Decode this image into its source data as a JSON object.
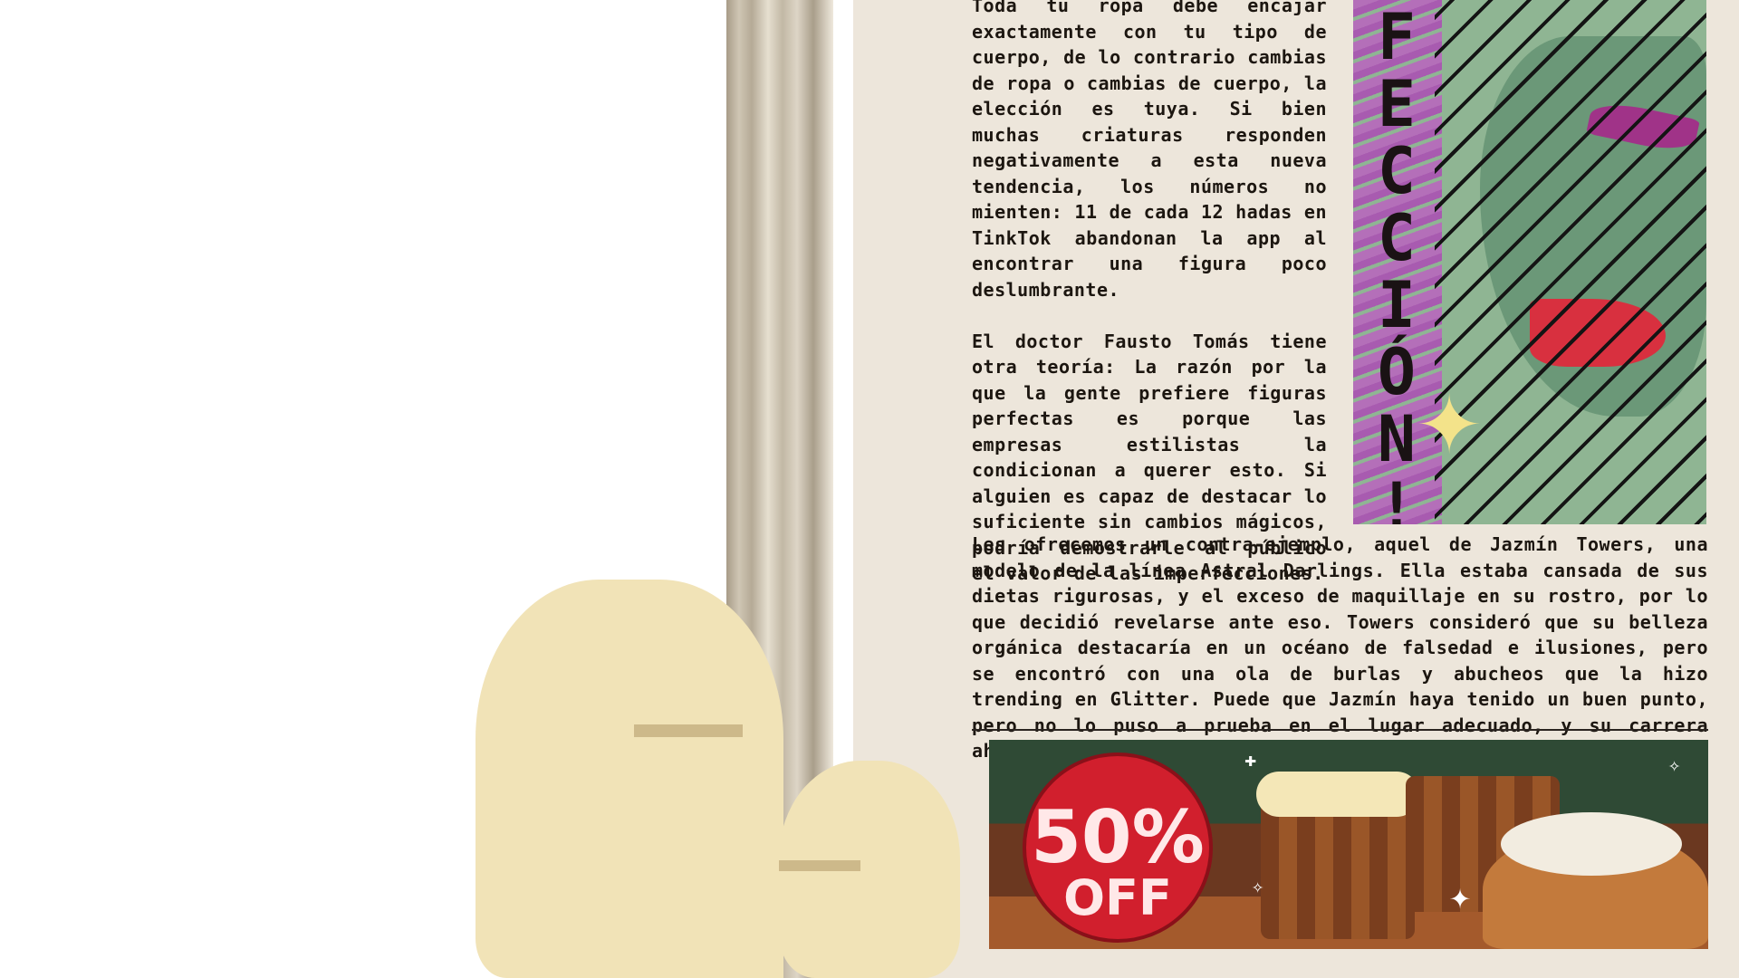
{
  "article": {
    "paragraphs": [
      "Toda tu ropa debe encajar exactamente con tu tipo de cuerpo, de lo contrario cambias de ropa o cambias de cuerpo, la elección es tuya. Si bien muchas criaturas responden negativamente a esta nueva tendencia, los números no mienten: 11 de cada 12 hadas en TinkTok abandonan la app al encontrar una figura poco deslumbrante.",
      "El doctor Fausto Tomás tiene otra teoría: La razón por la que la gente prefiere figuras perfectas es porque las empresas estilistas la condicionan a querer esto. Si alguien es capaz de destacar lo suficiente sin cambios mágicos, podría demostrarle al público el valor de las imperfecciones."
    ],
    "wide_paragraph": "Les ofrecemos un contra-ejemplo, aquel de Jazmín Towers, una modelo de la línea Astral Darlings. Ella estaba cansada de sus dietas rigurosas, y el exceso de maquillaje en su rostro, por lo que decidió revelarse ante eso. Towers consideró que su belleza orgánica destacaría en un océano de falsedad e ilusiones, pero se encontró con una ola de burlas y abucheos que la hizo trending en Glitter. Puede que Jazmín haya tenido un buen punto, pero no lo puso a prueba en el lugar adecuado, y su carrera ahora paga las consecuencias."
  },
  "comic": {
    "strip_text": "FECCIÓN!?",
    "star_icon": "sparkle-star-icon"
  },
  "ad": {
    "badge_percent": "50%",
    "badge_off": "OFF"
  },
  "colors": {
    "paper": "#ede6db",
    "text": "#1c1610",
    "badge_red": "#d11f2d"
  }
}
